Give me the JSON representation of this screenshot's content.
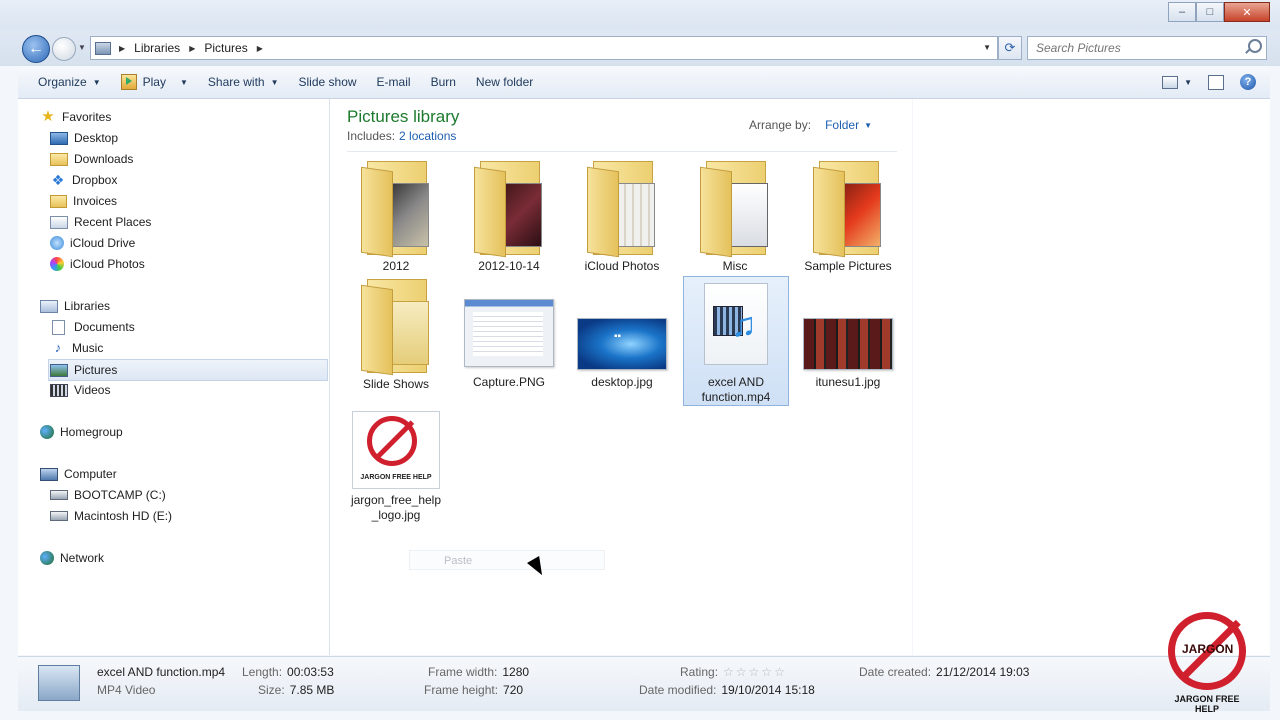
{
  "window": {
    "caption_buttons": [
      "–",
      "□",
      "✕"
    ]
  },
  "address": {
    "crumbs": [
      "Libraries",
      "Pictures"
    ],
    "search_placeholder": "Search Pictures"
  },
  "toolbar": {
    "organize": "Organize",
    "play": "Play",
    "share_with": "Share with",
    "slide_show": "Slide show",
    "email": "E-mail",
    "burn": "Burn",
    "new_folder": "New folder"
  },
  "nav": {
    "favorites": "Favorites",
    "desktop": "Desktop",
    "downloads": "Downloads",
    "dropbox": "Dropbox",
    "invoices": "Invoices",
    "recent_places": "Recent Places",
    "icloud_drive": "iCloud Drive",
    "icloud_photos": "iCloud Photos",
    "libraries": "Libraries",
    "documents": "Documents",
    "music": "Music",
    "pictures": "Pictures",
    "videos": "Videos",
    "homegroup": "Homegroup",
    "computer": "Computer",
    "bootcamp": "BOOTCAMP (C:)",
    "macintosh": "Macintosh HD (E:)",
    "network": "Network"
  },
  "content": {
    "title": "Pictures library",
    "includes_label": "Includes:",
    "includes_link": "2 locations",
    "arrange_label": "Arrange by:",
    "arrange_value": "Folder",
    "items": [
      "2012",
      "2012-10-14",
      "iCloud Photos",
      "Misc",
      "Sample Pictures",
      "Slide Shows",
      "Capture.PNG",
      "desktop.jpg",
      "excel AND function.mp4",
      "itunesu1.jpg",
      "jargon_free_help_logo.jpg"
    ],
    "paste": "Paste",
    "logo_thumb_caption": "JARGON FREE HELP"
  },
  "details": {
    "name": "excel AND function.mp4",
    "type": "MP4 Video",
    "length_label": "Length:",
    "length": "00:03:53",
    "size_label": "Size:",
    "size": "7.85 MB",
    "frame_width_label": "Frame width:",
    "frame_width": "1280",
    "frame_height_label": "Frame height:",
    "frame_height": "720",
    "rating_label": "Rating:",
    "rating_stars": "☆☆☆☆☆",
    "date_modified_label": "Date modified:",
    "date_modified": "19/10/2014 15:18",
    "date_created_label": "Date created:",
    "date_created": "21/12/2014 19:03"
  },
  "watermark": {
    "word": "JARGON",
    "caption": "JARGON FREE HELP"
  }
}
